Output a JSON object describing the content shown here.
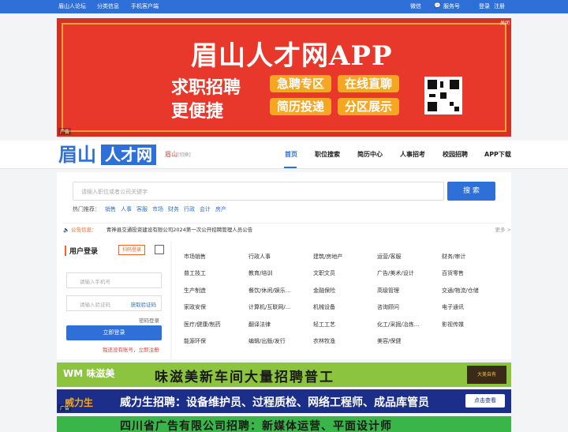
{
  "topbar": {
    "left": [
      "眉山人论坛",
      "分类信息",
      "手机客户端"
    ],
    "wechat": "微信",
    "service": "服务号",
    "login": "登录",
    "register": "注册"
  },
  "banner": {
    "title": "眉山人才网APP",
    "slogan1": "求职招聘",
    "slogan2": "更便捷",
    "pills": [
      "急聘专区",
      "在线直聊",
      "简历投递",
      "分区展示"
    ],
    "ad_tag": "广告",
    "close": "关闭"
  },
  "header": {
    "logo_part1": "眉山",
    "logo_part2": "人才网",
    "city": "眉山",
    "city_switch": "[切换]",
    "nav": [
      "首页",
      "职位搜索",
      "简历中心",
      "人事招考",
      "校园招聘",
      "APP下载"
    ]
  },
  "search": {
    "placeholder": "请输入职位或者公司关键字",
    "button": "搜 索",
    "hot_label": "热门推荐：",
    "hot": [
      "销售",
      "人事",
      "客服",
      "市场",
      "财务",
      "行政",
      "会计",
      "房产"
    ],
    "notice_label": "公告信息：",
    "notice_text": "青神县交通投资建设有限公司2024第一次公开招聘管理人员公告",
    "more": "更多 >"
  },
  "login": {
    "title": "用户登录",
    "scan": "扫码登录",
    "phone_placeholder": "请输入手机号",
    "code_placeholder": "请输入验证码",
    "get_code": "获取验证码",
    "password_login": "密码登录",
    "submit": "立即登录",
    "register": "我还没有账号，立即注册"
  },
  "categories": [
    [
      "市场销售",
      "行政人事",
      "建筑/房地产",
      "运营/客服",
      "财务/审计"
    ],
    [
      "普工技工",
      "教育/培训",
      "文职文员",
      "广告/美术/设计",
      "百货零售"
    ],
    [
      "生产制造",
      "餐饮/休闲/娱乐...",
      "金融保险",
      "高级管理",
      "交通/物流/仓储"
    ],
    [
      "家政安保",
      "计算机/互联网/...",
      "机械设备",
      "咨询顾问",
      "电子通讯"
    ],
    [
      "医疗/健康/制药",
      "翻译法律",
      "轻工工艺",
      "化工/采掘/冶炼...",
      "影视传媒"
    ],
    [
      "能源环保",
      "编辑/出版/发行",
      "农林牧渔",
      "美容/保健",
      ""
    ]
  ],
  "ads": {
    "ad1_logo": "味滋美",
    "ad1_text": "味滋美新车间大量招聘普工",
    "ad1_badge": "大美自有",
    "ad2_logo": "威力生",
    "ad2_text": "威力生招聘：设备维护员、过程质检、网络工程师、成品库管员",
    "ad2_button": "点击查看",
    "ad3_text": "四川省广告有限公司招聘：新媒体运营、平面设计师",
    "ad_tag": "广告"
  }
}
